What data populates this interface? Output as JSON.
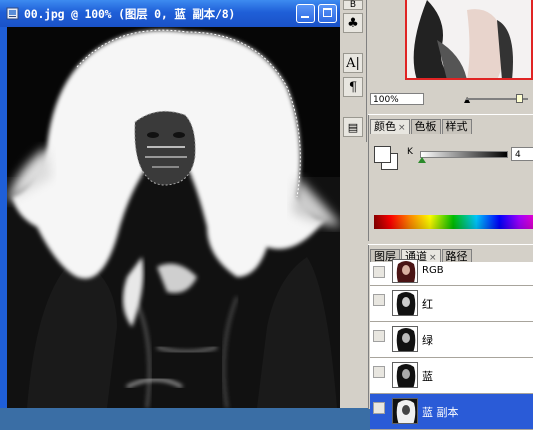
{
  "document": {
    "title": "00.jpg @ 100% (图层 0, 蓝 副本/8)"
  },
  "tools": {
    "items": [
      {
        "glyph": "B"
      },
      {
        "glyph": "♣"
      },
      {
        "glyph": "A|"
      },
      {
        "glyph": "¶"
      },
      {
        "glyph": "▤"
      }
    ]
  },
  "navigator": {
    "zoom": "100%"
  },
  "color_panel": {
    "tabs": [
      {
        "label": "颜色",
        "close": "×"
      },
      {
        "label": "色板",
        "close": ""
      },
      {
        "label": "样式",
        "close": ""
      }
    ],
    "k_label": "K",
    "k_value": "4"
  },
  "channels_panel": {
    "tabs": [
      {
        "label": "图层",
        "close": ""
      },
      {
        "label": "通道",
        "close": "×"
      },
      {
        "label": "路径",
        "close": ""
      }
    ],
    "channels": [
      {
        "name": "RGB"
      },
      {
        "name": "红"
      },
      {
        "name": "绿"
      },
      {
        "name": "蓝"
      },
      {
        "name": "蓝 副本"
      }
    ]
  },
  "colors": {
    "title_bar": "#1f5fd8",
    "selection": "#2a5bd7",
    "nav_frame": "#e02424"
  }
}
